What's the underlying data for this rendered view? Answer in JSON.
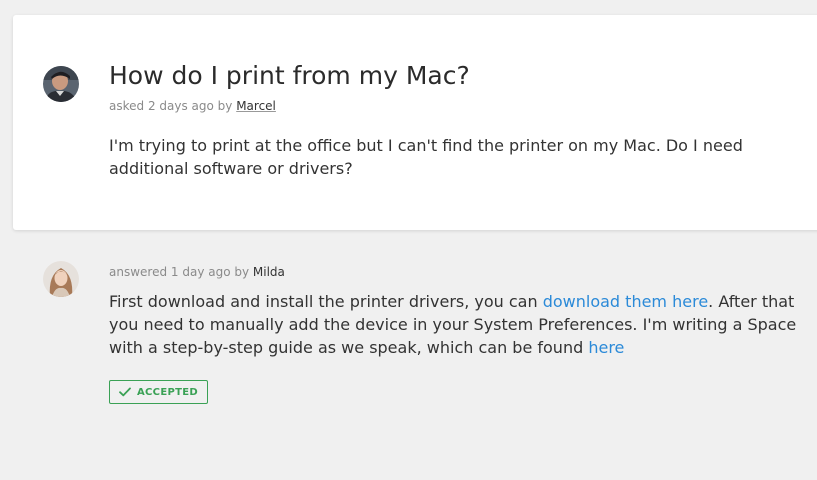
{
  "question": {
    "title": "How do I print from my Mac?",
    "meta_prefix": "asked 2 days ago by ",
    "author": "Marcel",
    "body": "I'm trying to print at the office but I can't find the printer on my Mac. Do I need additional software or drivers?"
  },
  "answer": {
    "meta_prefix": "answered 1 day ago by ",
    "author": "Milda",
    "body_part1": "First download and install the printer drivers, you can ",
    "link1": "download them here",
    "body_part2": ". After that you need to manually add the device in your System Preferences. I'm writing a Space with a step-by-step guide as we speak, which can be found ",
    "link2": "here",
    "accepted_label": "ACCEPTED"
  },
  "icons": {
    "question_avatar": "user-avatar-marcel",
    "answer_avatar": "user-avatar-milda",
    "accepted": "checkmark-icon"
  },
  "colors": {
    "link": "#2b8ad8",
    "accepted": "#3aa155",
    "background": "#f0f0f0"
  }
}
